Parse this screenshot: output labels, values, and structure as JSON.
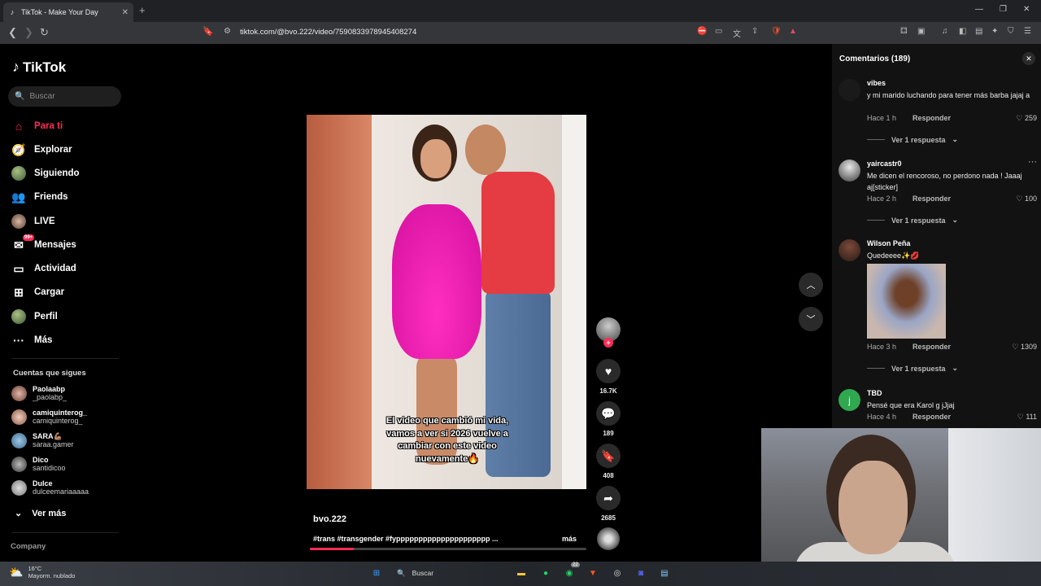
{
  "browser": {
    "tab_title": "TikTok - Make Your Day",
    "url": "tiktok.com/@bvo.222/video/7590833978945408274",
    "new_tab": "+",
    "tab_close": "✕"
  },
  "sidebar": {
    "logo": "TikTok",
    "search_placeholder": "Buscar",
    "nav": [
      {
        "label": "Para ti",
        "icon": "home-icon"
      },
      {
        "label": "Explorar",
        "icon": "compass-icon"
      },
      {
        "label": "Siguiendo",
        "icon": "following-avatar"
      },
      {
        "label": "Friends",
        "icon": "friends-icon"
      },
      {
        "label": "LIVE",
        "icon": "live-avatar"
      },
      {
        "label": "Mensajes",
        "icon": "messages-icon",
        "badge": "99+"
      },
      {
        "label": "Actividad",
        "icon": "activity-icon"
      },
      {
        "label": "Cargar",
        "icon": "upload-icon"
      },
      {
        "label": "Perfil",
        "icon": "profile-avatar"
      },
      {
        "label": "Más",
        "icon": "more-icon"
      }
    ],
    "following_title": "Cuentas que sigues",
    "following": [
      {
        "name": "Paolaabp",
        "handle": "_paolabp_"
      },
      {
        "name": "camiquinterog_",
        "handle": "camiquinterog_"
      },
      {
        "name": "SARA💪🏽",
        "handle": "saraa.gamer"
      },
      {
        "name": "Dico",
        "handle": "santidicoo"
      },
      {
        "name": "Dulce",
        "handle": "dulceemariaaaaa"
      }
    ],
    "see_more": "Ver más",
    "company": "Company"
  },
  "video": {
    "caption": "El video que cambió mi vida, vamos a ver si 2026 vuelve a cambiar con este video nuevamente🔥",
    "author": "bvo.222",
    "tags": "#trans #transgender #fyppppppppppppppppppppp ...",
    "more": "más",
    "progress": 0.16,
    "likes": "16.7K",
    "comments": "189",
    "saves": "408",
    "shares": "2685"
  },
  "comments_panel": {
    "title": "Comentarios (189)",
    "items": [
      {
        "user": "vibes",
        "text": "y mi marido luchando para tener más barba jajaj a",
        "time": "Hace 1 h",
        "reply": "Responder",
        "likes": "259",
        "replies": "Ver 1 respuesta"
      },
      {
        "user": "yaircastr0",
        "text": "Me dicen el rencoroso, no perdono nada ! Jaaaj aj[sticker]",
        "time": "Hace 2 h",
        "reply": "Responder",
        "likes": "100",
        "replies": "Ver 1 respuesta"
      },
      {
        "user": "Wilson Peña",
        "text": "Quedeeee✨💋",
        "time": "Hace 3 h",
        "reply": "Responder",
        "likes": "1309",
        "replies": "Ver 1 respuesta"
      },
      {
        "user": "TBD",
        "text": "Pensé que era Karol g jJjaj",
        "time": "Hace 4 h",
        "reply": "Responder",
        "likes": "111",
        "avatar_letter": "j"
      }
    ]
  },
  "taskbar": {
    "temp": "16°C",
    "weather": "Mayorm. nublado",
    "search": "Buscar",
    "whatsapp_badge": "22"
  },
  "colors": {
    "accent": "#fe2c55",
    "panel": "#121212"
  }
}
